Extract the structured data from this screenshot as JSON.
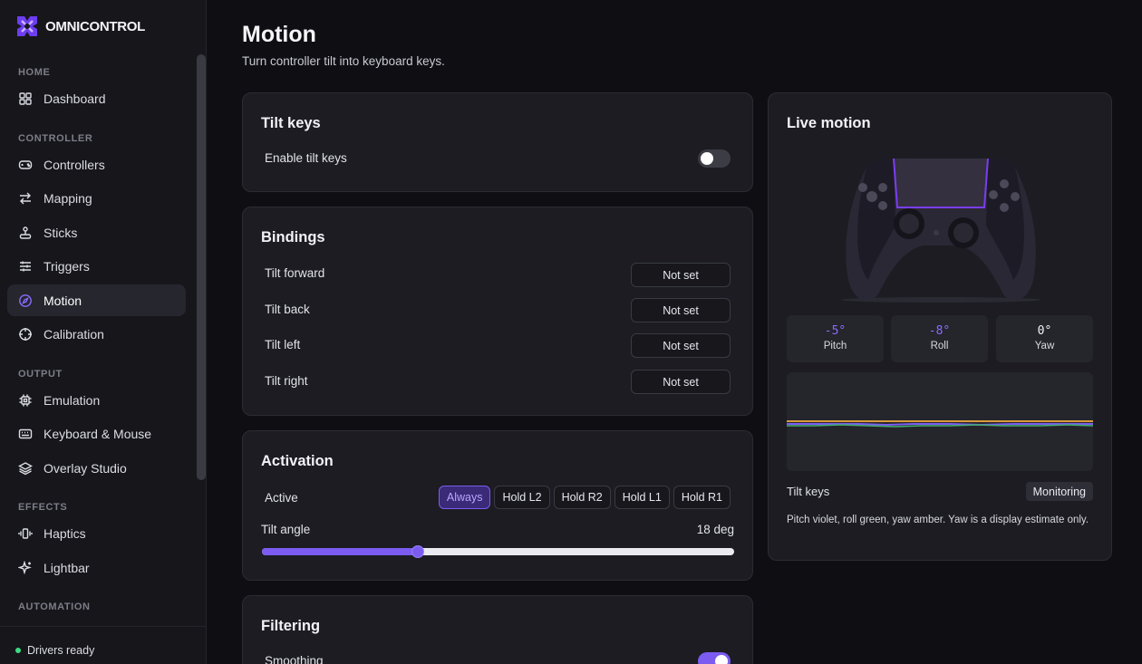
{
  "app": {
    "name": "OMNICONTROL"
  },
  "sidebar": {
    "sections": {
      "home": "HOME",
      "controller": "CONTROLLER",
      "output": "OUTPUT",
      "effects": "EFFECTS",
      "automation": "AUTOMATION"
    },
    "items": [
      {
        "label": "Dashboard",
        "icon": "grid-icon"
      },
      {
        "label": "Controllers",
        "icon": "gamepad-icon"
      },
      {
        "label": "Mapping",
        "icon": "arrows-icon"
      },
      {
        "label": "Sticks",
        "icon": "joystick-icon"
      },
      {
        "label": "Triggers",
        "icon": "sliders-icon"
      },
      {
        "label": "Motion",
        "icon": "compass-icon",
        "active": true
      },
      {
        "label": "Calibration",
        "icon": "crosshair-icon"
      },
      {
        "label": "Emulation",
        "icon": "chip-icon"
      },
      {
        "label": "Keyboard & Mouse",
        "icon": "keyboard-icon"
      },
      {
        "label": "Overlay Studio",
        "icon": "layers-icon"
      },
      {
        "label": "Haptics",
        "icon": "vibrate-icon"
      },
      {
        "label": "Lightbar",
        "icon": "sparkle-icon"
      }
    ],
    "status": "Drivers ready"
  },
  "page": {
    "title": "Motion",
    "subtitle": "Turn controller tilt into keyboard keys."
  },
  "tilt_keys": {
    "title": "Tilt keys",
    "enable_label": "Enable tilt keys",
    "enabled": false
  },
  "bindings": {
    "title": "Bindings",
    "rows": [
      {
        "label": "Tilt forward",
        "value": "Not set"
      },
      {
        "label": "Tilt back",
        "value": "Not set"
      },
      {
        "label": "Tilt left",
        "value": "Not set"
      },
      {
        "label": "Tilt right",
        "value": "Not set"
      }
    ]
  },
  "activation": {
    "title": "Activation",
    "active_label": "Active",
    "options": [
      "Always",
      "Hold L2",
      "Hold R2",
      "Hold L1",
      "Hold R1"
    ],
    "selected": "Always",
    "angle_label": "Tilt angle",
    "angle_value": "18 deg",
    "angle_fraction": 0.33
  },
  "filtering": {
    "title": "Filtering",
    "smoothing_label": "Smoothing",
    "smoothing_enabled": true
  },
  "live": {
    "title": "Live motion",
    "stats": [
      {
        "value": "-5°",
        "label": "Pitch",
        "color": "#8b6cff"
      },
      {
        "value": "-8°",
        "label": "Roll",
        "color": "#8b6cff"
      },
      {
        "value": "0°",
        "label": "Yaw",
        "color": "#f2f2f6"
      }
    ],
    "footer_label": "Tilt keys",
    "footer_badge": "Monitoring",
    "note": "Pitch violet, roll green, yaw amber. Yaw is a display estimate only."
  },
  "colors": {
    "accent": "#7c5cf0",
    "pitch": "#7c5cf0",
    "roll": "#3fae6a",
    "yaw": "#d99a3c",
    "ready": "#3ddc84"
  }
}
